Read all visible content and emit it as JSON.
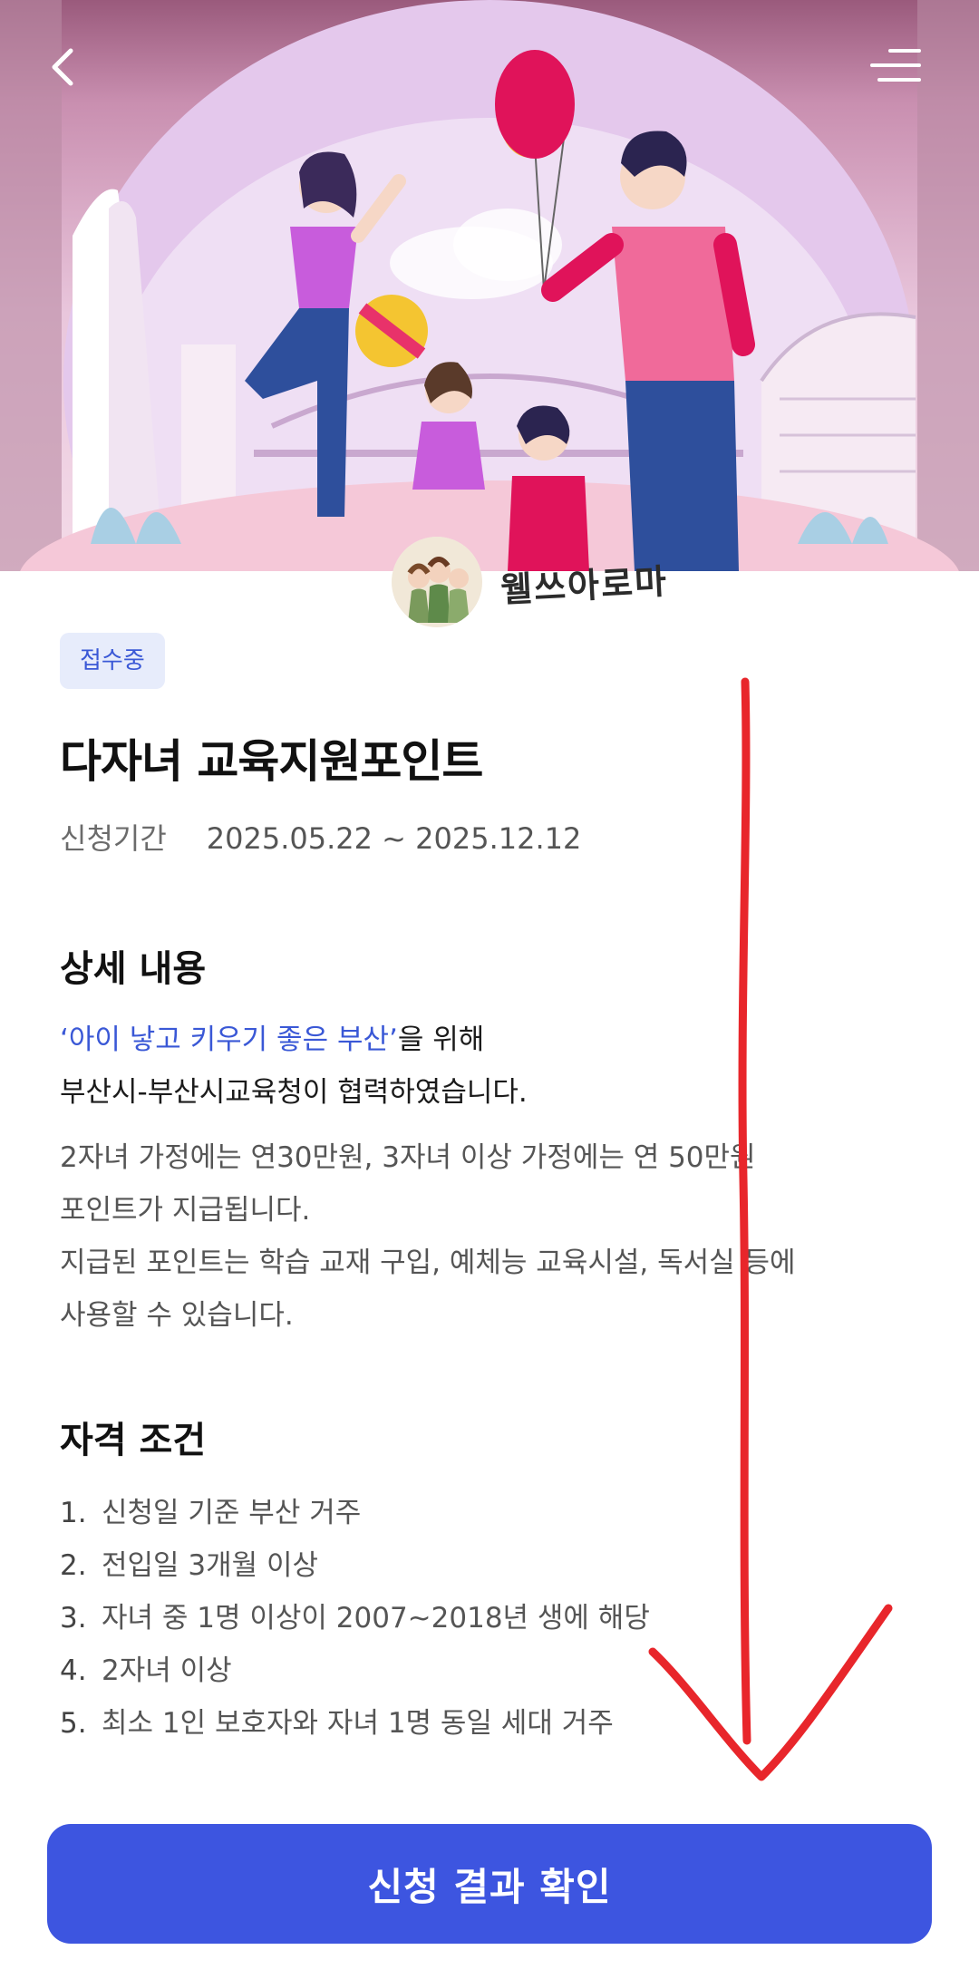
{
  "watermark": {
    "text": "웰쓰아로마"
  },
  "status_badge": "접수중",
  "program": {
    "title": "다자녀 교육지원포인트",
    "period_label": "신청기간",
    "period_value": "2025.05.22 ~ 2025.12.12"
  },
  "details": {
    "heading": "상세 내용",
    "highlight": "‘아이 낳고 키우기 좋은 부산’",
    "line1_suffix": "을 위해",
    "line2": "부산시-부산시교육청이 협력하였습니다.",
    "line3": "2자녀 가정에는 연30만원, 3자녀 이상 가정에는 연 50만원",
    "line4": "포인트가 지급됩니다.",
    "line5": "지급된 포인트는 학습 교재 구입, 예체능 교육시설, 독서실 등에",
    "line6": "사용할 수 있습니다."
  },
  "eligibility": {
    "heading": "자격 조건",
    "items": [
      {
        "num": "1.",
        "text": "신청일 기준 부산 거주"
      },
      {
        "num": "2.",
        "text": "전입일 3개월 이상"
      },
      {
        "num": "3.",
        "text": "자녀 중 1명 이상이 2007~2018년 생에 해당"
      },
      {
        "num": "4.",
        "text": "2자녀 이상"
      },
      {
        "num": "5.",
        "text": "최소 1인 보호자와 자녀 1명 동일 세대 거주"
      }
    ]
  },
  "cta": {
    "label": "신청 결과 확인"
  },
  "colors": {
    "accent": "#3d55e0",
    "badge_bg": "#e7ecfb",
    "highlight": "#3a58d6",
    "annotation": "#e8262b"
  }
}
